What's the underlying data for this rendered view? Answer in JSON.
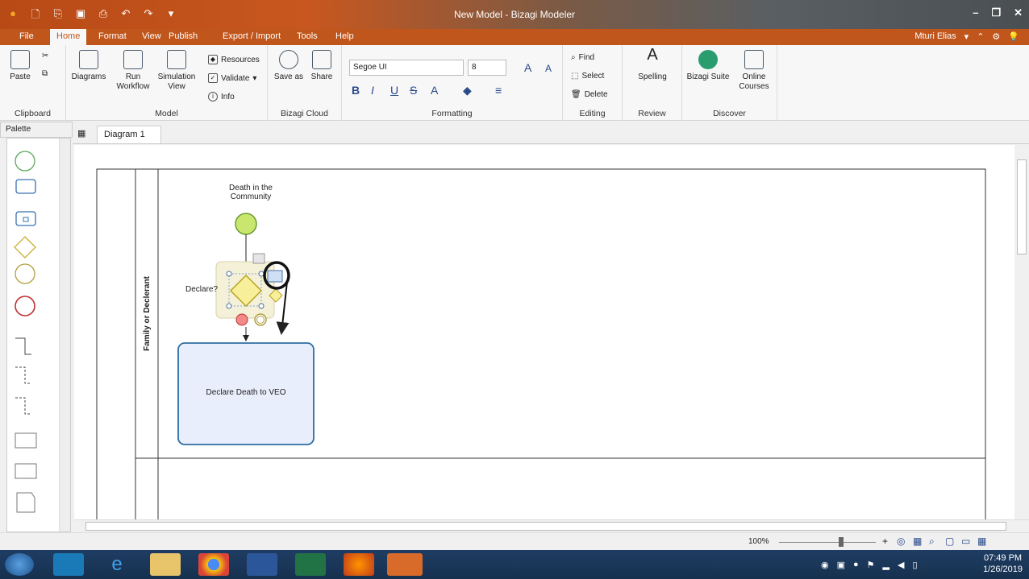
{
  "window": {
    "title": "New Model - Bizagi Modeler"
  },
  "menu_tabs": [
    {
      "label": "File"
    },
    {
      "label": "Home"
    },
    {
      "label": "Format"
    },
    {
      "label": "View"
    },
    {
      "label": "Publish"
    },
    {
      "label": "Export / Import"
    },
    {
      "label": "Tools"
    },
    {
      "label": "Help"
    }
  ],
  "user": {
    "name": "Mturi Elias"
  },
  "ribbon": {
    "clipboard": {
      "paste": "Paste",
      "group": "Clipboard"
    },
    "model": {
      "diagrams": "Diagrams",
      "run_workflow": "Run Workflow",
      "simulation_view": "Simulation View",
      "resources": "Resources",
      "validate": "Validate",
      "info": "Info",
      "group": "Model"
    },
    "cloud": {
      "save_as": "Save as",
      "share": "Share",
      "group": "Bizagi Cloud"
    },
    "formatting": {
      "font": "Segoe UI",
      "size": "8",
      "group": "Formatting"
    },
    "editing": {
      "find": "Find",
      "select": "Select",
      "delete": "Delete",
      "group": "Editing"
    },
    "review": {
      "spelling": "Spelling",
      "group": "Review"
    },
    "discover": {
      "suite": "Bizagi Suite",
      "courses": "Online Courses",
      "group": "Discover"
    }
  },
  "palette": {
    "title": "Palette"
  },
  "doc_tab": {
    "label": "Diagram 1"
  },
  "diagram": {
    "lane_label": "Family or Declerant",
    "start_event_label": "Death in the Community",
    "gateway_label": "Declare?",
    "task_label": "Declare Death to VEO"
  },
  "status": {
    "zoom": "100%"
  },
  "clock": {
    "time": "07:49 PM",
    "date": "1/26/2019"
  }
}
